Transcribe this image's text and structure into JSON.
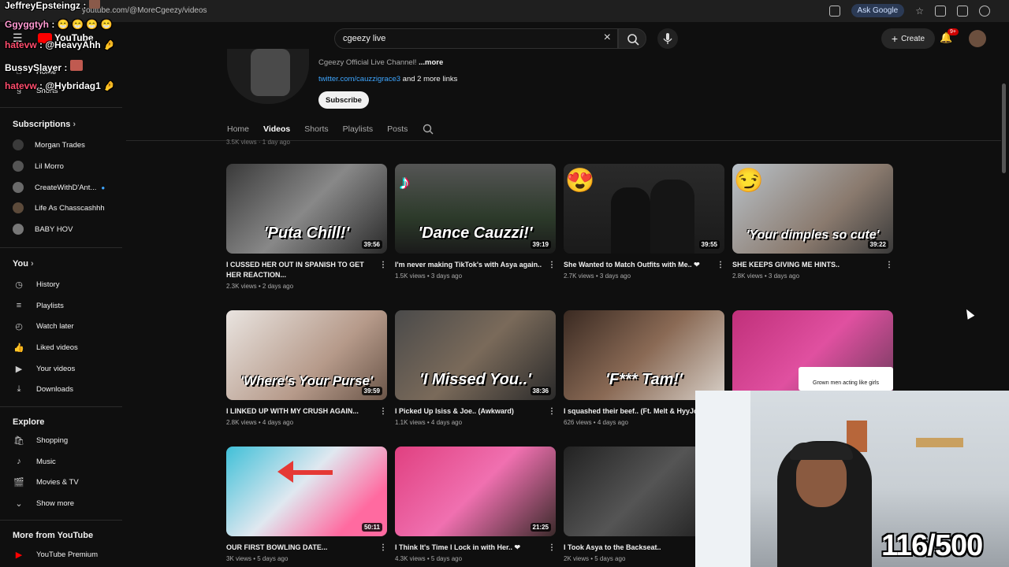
{
  "browser": {
    "url": "youtube.com/@MoreCgeezy/videos",
    "ask_google": "Ask Google"
  },
  "topbar": {
    "logo": "YouTube",
    "search_value": "cgeezy live",
    "create_label": "Create",
    "notif_badge": "9+"
  },
  "chat": [
    {
      "name": "JeffreyEpsteingz",
      "sep": " : ",
      "msg": "",
      "color": "white"
    },
    {
      "name": "Ggyggtyh",
      "sep": " : ",
      "msg": "😁 😁 😁 😁",
      "color": "pink"
    },
    {
      "name": "hatevw",
      "sep": " : ",
      "msg": "@HeavyAhh",
      "color": "red"
    },
    {
      "name": "BussySlayer",
      "sep": " : ",
      "msg": "",
      "color": "white"
    },
    {
      "name": "hatevw",
      "sep": " : ",
      "msg": "@Hybridag1",
      "color": "red"
    }
  ],
  "sidebar": {
    "home": "Home",
    "shorts": "Shorts",
    "subscriptions_title": "Subscriptions",
    "subscriptions": [
      {
        "label": "Morgan Trades",
        "color": "#3a3a3a"
      },
      {
        "label": "Lil Morro",
        "color": "#555"
      },
      {
        "label": "CreateWithD'Ant...",
        "color": "#6a6a6a"
      },
      {
        "label": "Life As Chasscashhh",
        "color": "#5c4a3a"
      },
      {
        "label": "BABY HOV",
        "color": "#777"
      }
    ],
    "you_title": "You",
    "you_items": [
      {
        "label": "History",
        "icon": "history-icon"
      },
      {
        "label": "Playlists",
        "icon": "playlists-icon"
      },
      {
        "label": "Watch later",
        "icon": "watch-later-icon"
      },
      {
        "label": "Liked videos",
        "icon": "like-icon"
      },
      {
        "label": "Your videos",
        "icon": "your-videos-icon"
      },
      {
        "label": "Downloads",
        "icon": "download-icon"
      }
    ],
    "explore_title": "Explore",
    "explore_items": [
      {
        "label": "Shopping",
        "icon": "shopping-icon"
      },
      {
        "label": "Music",
        "icon": "music-icon"
      },
      {
        "label": "Movies & TV",
        "icon": "movies-icon"
      },
      {
        "label": "Show more",
        "icon": "chevron-down-icon"
      }
    ],
    "more_title": "More from YouTube",
    "premium": "YouTube Premium"
  },
  "channel": {
    "description": "Cgeezy Official Live Channel!",
    "more": " ...more",
    "link": "twitter.com/cauzzigrace3",
    "more_links": " and 2 more links",
    "subscribe": "Subscribe"
  },
  "tabs": [
    "Home",
    "Videos",
    "Shorts",
    "Playlists",
    "Posts"
  ],
  "prev_meta": "3.5K views · 1 day ago",
  "videos": [
    {
      "title": "I CUSSED HER OUT IN SPANISH TO GET HER REACTION...",
      "meta": "2.3K views • 2 days ago",
      "duration": "39:56",
      "thumb_text": "'Puta Chill!'",
      "bg": "linear-gradient(135deg,#3a3a3a,#888 50%,#2a2a2a)"
    },
    {
      "title": "I'm never making TikTok's with Asya again..",
      "meta": "1.5K views • 3 days ago",
      "duration": "39:19",
      "thumb_text": "'Dance Cauzzi!'",
      "bg": "linear-gradient(180deg,#555 0%,#2c3a2a 60%,#1a1a1a)"
    },
    {
      "title": "She Wanted to Match Outfits with Me.. ❤",
      "meta": "2.7K views • 3 days ago",
      "duration": "39:55",
      "thumb_text": "",
      "bg": "linear-gradient(180deg,#2a2a2a,#1a1a1a)"
    },
    {
      "title": "SHE KEEPS GIVING ME HINTS..",
      "meta": "2.8K views • 3 days ago",
      "duration": "39:22",
      "thumb_text": "'Your dimples so cute'",
      "bg": "linear-gradient(135deg,#b9c2c9,#8a7a6e 60%,#3a3a3a)"
    },
    {
      "title": "I LINKED UP WITH MY CRUSH AGAIN...",
      "meta": "2.8K views • 4 days ago",
      "duration": "39:59",
      "thumb_text": "'Where's Your Purse'",
      "bg": "linear-gradient(135deg,#e9e4e0,#b69a8a 60%,#6a5548)"
    },
    {
      "title": "I Picked Up Isiss & Joe.. (Awkward)",
      "meta": "1.1K views • 4 days ago",
      "duration": "38:36",
      "thumb_text": "'I Missed You..'",
      "bg": "linear-gradient(135deg,#4a4a4a,#7a6a5a 50%,#2a2a2a)"
    },
    {
      "title": "I squashed their beef.. (Ft. Melt & HyyJo...",
      "meta": "626 views • 4 days ago",
      "duration": "",
      "thumb_text": "'F*** Tam!'",
      "bg": "linear-gradient(135deg,#3a2a22,#8a6a55 50%,#d8d0c8)"
    },
    {
      "title": "",
      "meta": "",
      "duration": "",
      "thumb_text": "",
      "bg": "linear-gradient(135deg,#c0307a,#e050a0 50%,#6a3a5a)"
    },
    {
      "title": "OUR FIRST BOWLING DATE...",
      "meta": "3K views • 5 days ago",
      "duration": "50:11",
      "thumb_text": "",
      "bg": "linear-gradient(135deg,#40c0d8,#e0e8f0 45%,#ff6aa0 80%)"
    },
    {
      "title": "I Think It's Time I Lock in with Her.. ❤",
      "meta": "4.3K views • 5 days ago",
      "duration": "21:25",
      "thumb_text": "",
      "bg": "linear-gradient(135deg,#e04080,#f070b0 50%,#3a2a2a)"
    },
    {
      "title": "I Took Asya to the Backseat..",
      "meta": "2K views • 5 days ago",
      "duration": "",
      "thumb_text": "",
      "bg": "linear-gradient(135deg,#222,#555 50%,#1a1a1a)"
    }
  ],
  "overlay": {
    "tweet_line": "Grown men acting like girls",
    "counter": "116/500"
  }
}
